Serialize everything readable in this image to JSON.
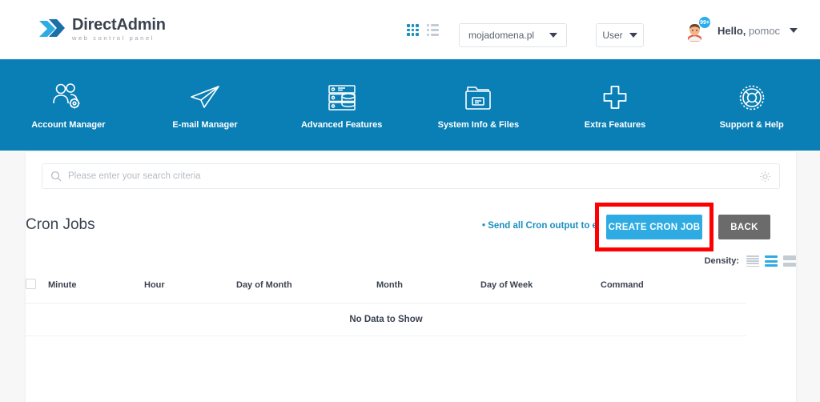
{
  "header": {
    "logo": {
      "title_bold": "Direct",
      "title_rest": "Admin",
      "tagline": "web control panel",
      "icon": "chevrons-logo-icon"
    },
    "view_toggle": {
      "grid_icon": "grid-view-icon",
      "list_icon": "list-view-icon",
      "active": "grid"
    },
    "domain_select": {
      "value": "mojadomena.pl",
      "caret": "chevron-down-icon"
    },
    "user_select": {
      "value": "User",
      "caret": "chevron-down-icon"
    },
    "account": {
      "avatar_icon": "user-avatar",
      "notification_badge": "99+",
      "greeting": "Hello,",
      "username": "pomoc",
      "caret": "chevron-down-icon"
    }
  },
  "nav": {
    "items": [
      {
        "label": "Account Manager",
        "icon": "users-gear-icon"
      },
      {
        "label": "E-mail Manager",
        "icon": "paper-plane-icon"
      },
      {
        "label": "Advanced Features",
        "icon": "database-server-icon"
      },
      {
        "label": "System Info & Files",
        "icon": "file-box-icon"
      },
      {
        "label": "Extra Features",
        "icon": "plus-icon"
      },
      {
        "label": "Support & Help",
        "icon": "lifebuoy-icon"
      }
    ]
  },
  "search": {
    "placeholder": "Please enter your search criteria",
    "value": "",
    "search_icon": "search-icon",
    "settings_icon": "gear-icon"
  },
  "main": {
    "page_title": "Cron Jobs",
    "cron_output_link": "• Send all Cron output to e-mail",
    "create_button": "CREATE CRON JOB",
    "back_button": "BACK",
    "highlight_color": "#ff0000",
    "density": {
      "label": "Density:",
      "options": [
        "compact-density-icon",
        "medium-density-icon",
        "comfortable-density-icon"
      ],
      "active_index": 1
    },
    "table": {
      "columns": [
        "Minute",
        "Hour",
        "Day of Month",
        "Month",
        "Day of Week",
        "Command"
      ],
      "select_all_checkbox": "select-all-checkbox",
      "rows": [],
      "empty_message": "No Data to Show"
    }
  },
  "colors": {
    "banner_blue": "#0a7fb5",
    "accent_blue": "#2eabe2",
    "link_blue": "#1a8fc1",
    "back_gray": "#6b6b6b",
    "text_dark": "#3b4350"
  }
}
